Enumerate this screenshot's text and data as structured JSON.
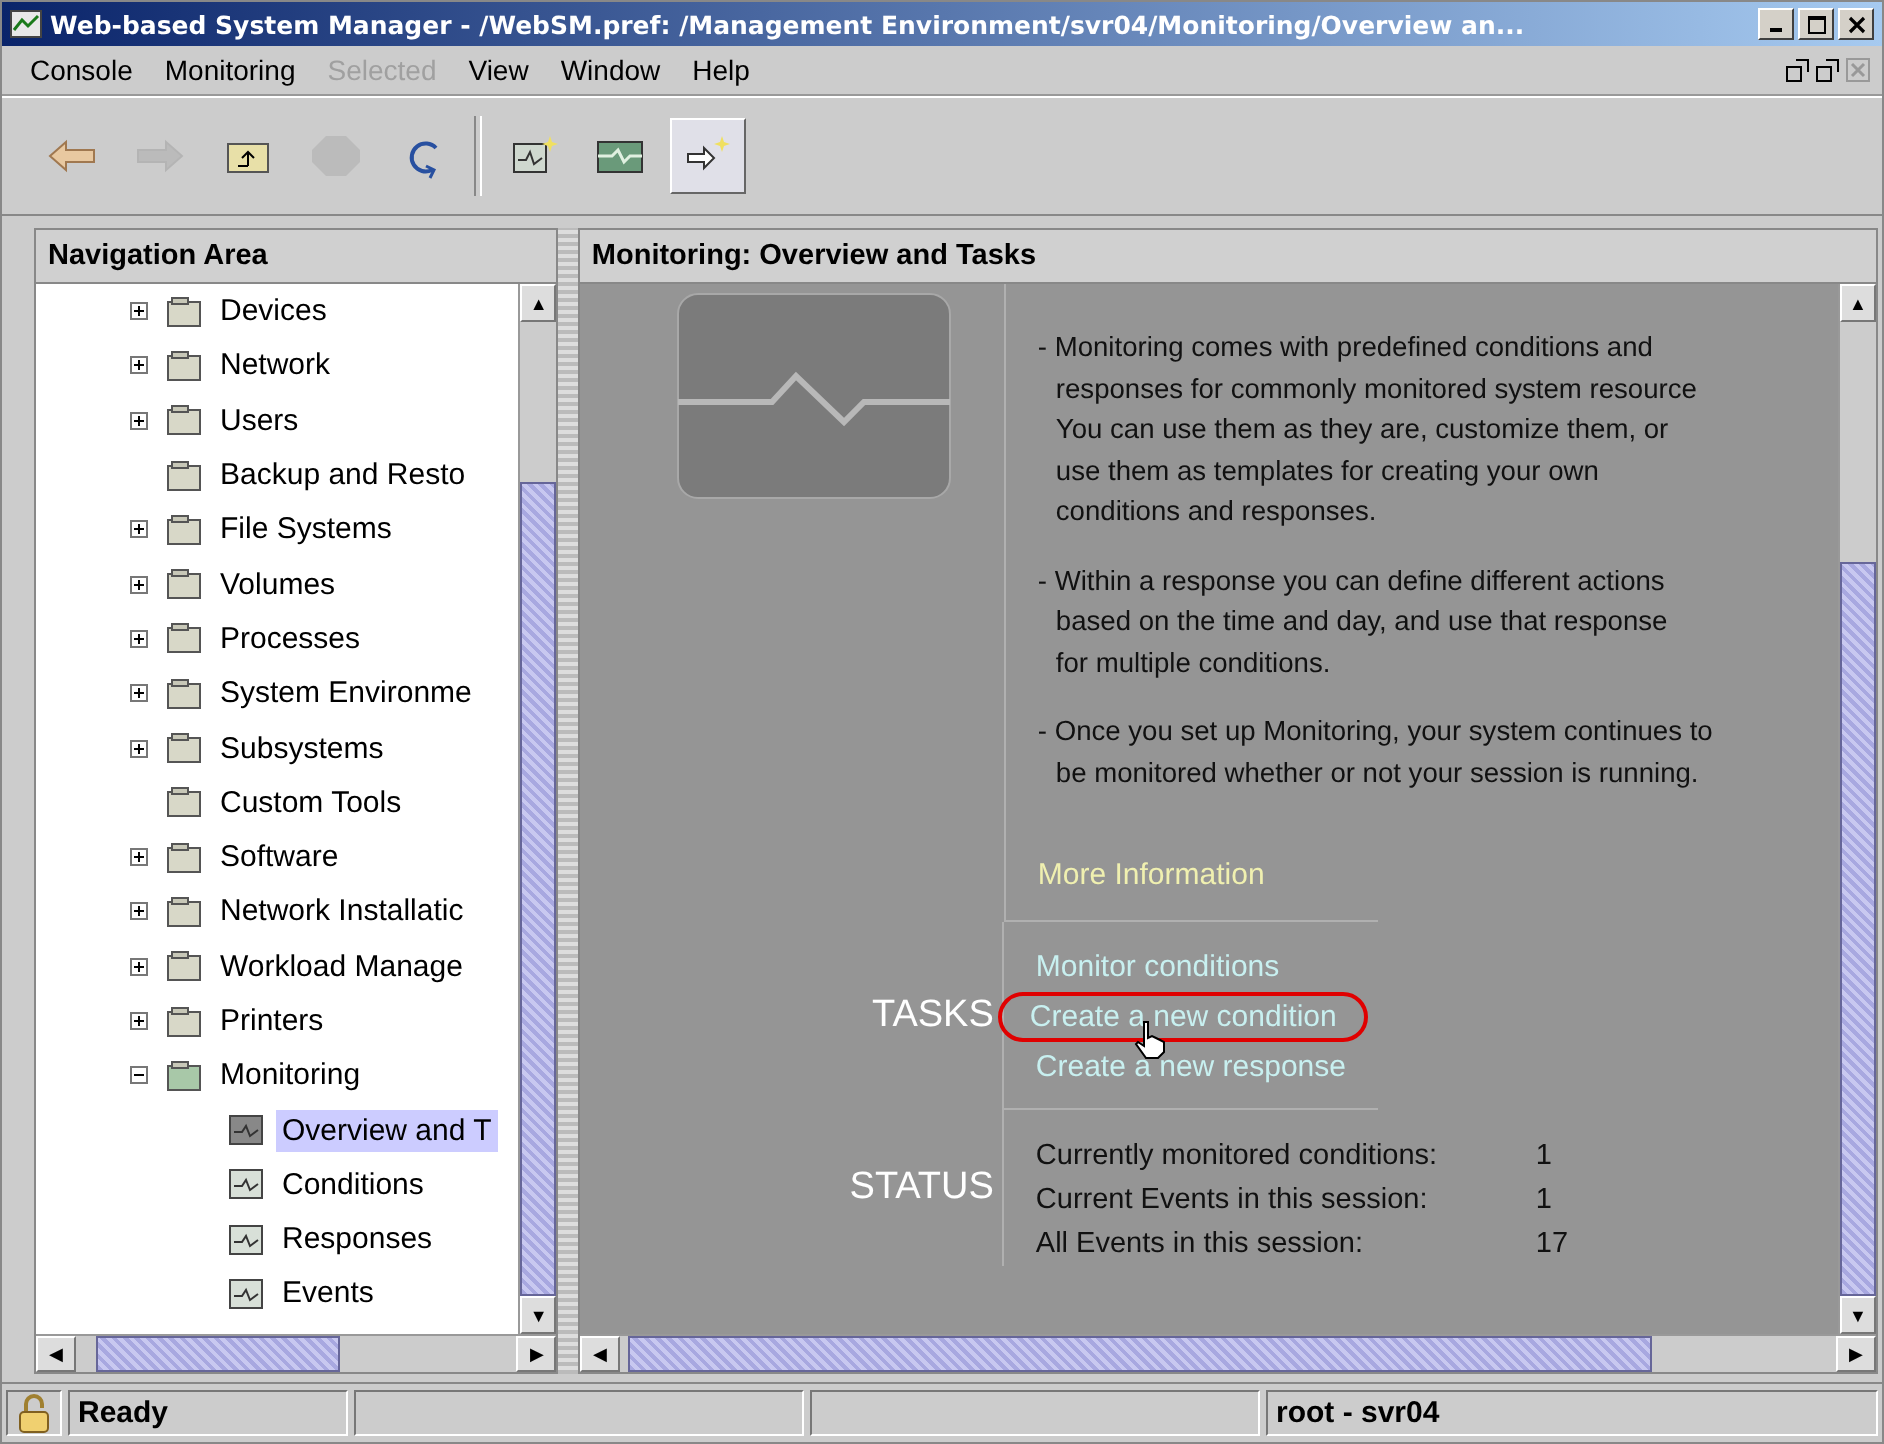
{
  "window": {
    "title": "Web-based System Manager - /WebSM.pref: /Management Environment/svr04/Monitoring/Overview an..."
  },
  "menu": [
    {
      "label": "Console",
      "disabled": false
    },
    {
      "label": "Monitoring",
      "disabled": false
    },
    {
      "label": "Selected",
      "disabled": true
    },
    {
      "label": "View",
      "disabled": false
    },
    {
      "label": "Window",
      "disabled": false
    },
    {
      "label": "Help",
      "disabled": false
    }
  ],
  "toolbar": [
    {
      "kind": "back",
      "disabled": false,
      "pressed": false
    },
    {
      "kind": "forward",
      "disabled": true,
      "pressed": false
    },
    {
      "kind": "up",
      "disabled": false,
      "pressed": false
    },
    {
      "kind": "stop",
      "disabled": true,
      "pressed": false
    },
    {
      "kind": "refresh",
      "disabled": false,
      "pressed": false
    },
    {
      "kind": "separator"
    },
    {
      "kind": "new-condition",
      "disabled": false,
      "pressed": false
    },
    {
      "kind": "monitor",
      "disabled": false,
      "pressed": false
    },
    {
      "kind": "new-response",
      "disabled": false,
      "pressed": true
    }
  ],
  "scroll_arrows": {
    "up": "▲",
    "down": "▼",
    "left": "◀",
    "right": "▶"
  },
  "navigation": {
    "title": "Navigation Area",
    "items": [
      {
        "label": "Devices",
        "expanded": false,
        "selected": false
      },
      {
        "label": "Network",
        "expanded": false,
        "selected": false
      },
      {
        "label": "Users",
        "expanded": false,
        "selected": false
      },
      {
        "label": "Backup and Resto",
        "selected": false
      },
      {
        "label": "File Systems",
        "expanded": false,
        "selected": false
      },
      {
        "label": "Volumes",
        "expanded": false,
        "selected": false
      },
      {
        "label": "Processes",
        "expanded": false,
        "selected": false
      },
      {
        "label": "System Environme",
        "expanded": false,
        "selected": false
      },
      {
        "label": "Subsystems",
        "expanded": false,
        "selected": false
      },
      {
        "label": "Custom Tools",
        "selected": false
      },
      {
        "label": "Software",
        "expanded": false,
        "selected": false
      },
      {
        "label": "Network Installatic",
        "expanded": false,
        "selected": false
      },
      {
        "label": "Workload Manage",
        "expanded": false,
        "selected": false
      },
      {
        "label": "Printers",
        "expanded": false,
        "selected": false
      },
      {
        "label": "Monitoring",
        "expanded": true,
        "selected": false,
        "children": [
          {
            "label": "Overview and T",
            "selected": true
          },
          {
            "label": "Conditions",
            "selected": false
          },
          {
            "label": "Responses",
            "selected": false
          },
          {
            "label": "Events",
            "selected": false
          }
        ]
      }
    ]
  },
  "content": {
    "title": "Monitoring: Overview and Tasks",
    "paragraphs": [
      [
        "- Monitoring comes with predefined conditions and",
        "responses for commonly monitored system resource",
        "You can use them as they are, customize them, or",
        "use them as templates for creating your own",
        "conditions and responses."
      ],
      [
        "- Within a response you can define different actions",
        "based on the time and day, and use that response",
        "for multiple conditions."
      ],
      [
        "- Once you set up Monitoring, your system continues to",
        "be monitored whether or not your session is running."
      ]
    ],
    "more_information": "More Information",
    "tasks": {
      "heading": "TASKS",
      "links": [
        {
          "label": "Monitor conditions",
          "highlighted": false
        },
        {
          "label": "Create a new condition",
          "highlighted": true
        },
        {
          "label": "Create a new response",
          "highlighted": false
        }
      ]
    },
    "status": {
      "heading": "STATUS",
      "rows": [
        {
          "label": "Currently monitored conditions:",
          "value": "1"
        },
        {
          "label": "Current Events in this session:",
          "value": "1"
        },
        {
          "label": "All Events in this session:",
          "value": "17"
        }
      ]
    }
  },
  "status_bar": {
    "message": "Ready",
    "user": "root - svr04"
  }
}
